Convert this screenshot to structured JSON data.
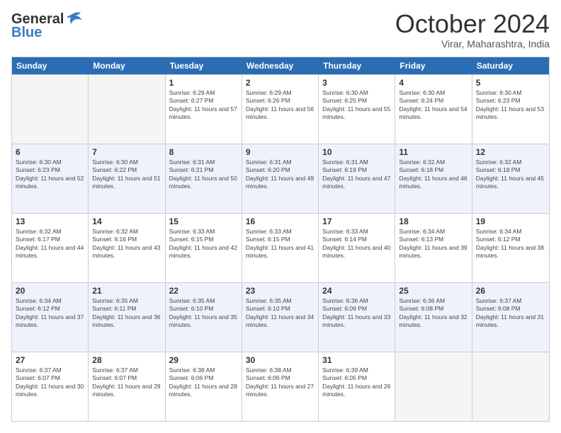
{
  "logo": {
    "text1": "General",
    "text2": "Blue"
  },
  "title": "October 2024",
  "location": "Virar, Maharashtra, India",
  "days_of_week": [
    "Sunday",
    "Monday",
    "Tuesday",
    "Wednesday",
    "Thursday",
    "Friday",
    "Saturday"
  ],
  "weeks": [
    {
      "alt": false,
      "cells": [
        {
          "day": "",
          "empty": true
        },
        {
          "day": "",
          "empty": true
        },
        {
          "day": "1",
          "sunrise": "Sunrise: 6:29 AM",
          "sunset": "Sunset: 6:27 PM",
          "daylight": "Daylight: 11 hours and 57 minutes."
        },
        {
          "day": "2",
          "sunrise": "Sunrise: 6:29 AM",
          "sunset": "Sunset: 6:26 PM",
          "daylight": "Daylight: 11 hours and 56 minutes."
        },
        {
          "day": "3",
          "sunrise": "Sunrise: 6:30 AM",
          "sunset": "Sunset: 6:25 PM",
          "daylight": "Daylight: 11 hours and 55 minutes."
        },
        {
          "day": "4",
          "sunrise": "Sunrise: 6:30 AM",
          "sunset": "Sunset: 6:24 PM",
          "daylight": "Daylight: 11 hours and 54 minutes."
        },
        {
          "day": "5",
          "sunrise": "Sunrise: 6:30 AM",
          "sunset": "Sunset: 6:23 PM",
          "daylight": "Daylight: 11 hours and 53 minutes."
        }
      ]
    },
    {
      "alt": true,
      "cells": [
        {
          "day": "6",
          "sunrise": "Sunrise: 6:30 AM",
          "sunset": "Sunset: 6:23 PM",
          "daylight": "Daylight: 11 hours and 52 minutes."
        },
        {
          "day": "7",
          "sunrise": "Sunrise: 6:30 AM",
          "sunset": "Sunset: 6:22 PM",
          "daylight": "Daylight: 11 hours and 51 minutes."
        },
        {
          "day": "8",
          "sunrise": "Sunrise: 6:31 AM",
          "sunset": "Sunset: 6:21 PM",
          "daylight": "Daylight: 11 hours and 50 minutes."
        },
        {
          "day": "9",
          "sunrise": "Sunrise: 6:31 AM",
          "sunset": "Sunset: 6:20 PM",
          "daylight": "Daylight: 11 hours and 49 minutes."
        },
        {
          "day": "10",
          "sunrise": "Sunrise: 6:31 AM",
          "sunset": "Sunset: 6:19 PM",
          "daylight": "Daylight: 11 hours and 47 minutes."
        },
        {
          "day": "11",
          "sunrise": "Sunrise: 6:32 AM",
          "sunset": "Sunset: 6:18 PM",
          "daylight": "Daylight: 11 hours and 46 minutes."
        },
        {
          "day": "12",
          "sunrise": "Sunrise: 6:32 AM",
          "sunset": "Sunset: 6:18 PM",
          "daylight": "Daylight: 11 hours and 45 minutes."
        }
      ]
    },
    {
      "alt": false,
      "cells": [
        {
          "day": "13",
          "sunrise": "Sunrise: 6:32 AM",
          "sunset": "Sunset: 6:17 PM",
          "daylight": "Daylight: 11 hours and 44 minutes."
        },
        {
          "day": "14",
          "sunrise": "Sunrise: 6:32 AM",
          "sunset": "Sunset: 6:16 PM",
          "daylight": "Daylight: 11 hours and 43 minutes."
        },
        {
          "day": "15",
          "sunrise": "Sunrise: 6:33 AM",
          "sunset": "Sunset: 6:15 PM",
          "daylight": "Daylight: 11 hours and 42 minutes."
        },
        {
          "day": "16",
          "sunrise": "Sunrise: 6:33 AM",
          "sunset": "Sunset: 6:15 PM",
          "daylight": "Daylight: 11 hours and 41 minutes."
        },
        {
          "day": "17",
          "sunrise": "Sunrise: 6:33 AM",
          "sunset": "Sunset: 6:14 PM",
          "daylight": "Daylight: 11 hours and 40 minutes."
        },
        {
          "day": "18",
          "sunrise": "Sunrise: 6:34 AM",
          "sunset": "Sunset: 6:13 PM",
          "daylight": "Daylight: 11 hours and 39 minutes."
        },
        {
          "day": "19",
          "sunrise": "Sunrise: 6:34 AM",
          "sunset": "Sunset: 6:12 PM",
          "daylight": "Daylight: 11 hours and 38 minutes."
        }
      ]
    },
    {
      "alt": true,
      "cells": [
        {
          "day": "20",
          "sunrise": "Sunrise: 6:34 AM",
          "sunset": "Sunset: 6:12 PM",
          "daylight": "Daylight: 11 hours and 37 minutes."
        },
        {
          "day": "21",
          "sunrise": "Sunrise: 6:35 AM",
          "sunset": "Sunset: 6:11 PM",
          "daylight": "Daylight: 11 hours and 36 minutes."
        },
        {
          "day": "22",
          "sunrise": "Sunrise: 6:35 AM",
          "sunset": "Sunset: 6:10 PM",
          "daylight": "Daylight: 11 hours and 35 minutes."
        },
        {
          "day": "23",
          "sunrise": "Sunrise: 6:35 AM",
          "sunset": "Sunset: 6:10 PM",
          "daylight": "Daylight: 11 hours and 34 minutes."
        },
        {
          "day": "24",
          "sunrise": "Sunrise: 6:36 AM",
          "sunset": "Sunset: 6:09 PM",
          "daylight": "Daylight: 11 hours and 33 minutes."
        },
        {
          "day": "25",
          "sunrise": "Sunrise: 6:36 AM",
          "sunset": "Sunset: 6:08 PM",
          "daylight": "Daylight: 11 hours and 32 minutes."
        },
        {
          "day": "26",
          "sunrise": "Sunrise: 6:37 AM",
          "sunset": "Sunset: 6:08 PM",
          "daylight": "Daylight: 11 hours and 31 minutes."
        }
      ]
    },
    {
      "alt": false,
      "cells": [
        {
          "day": "27",
          "sunrise": "Sunrise: 6:37 AM",
          "sunset": "Sunset: 6:07 PM",
          "daylight": "Daylight: 11 hours and 30 minutes."
        },
        {
          "day": "28",
          "sunrise": "Sunrise: 6:37 AM",
          "sunset": "Sunset: 6:07 PM",
          "daylight": "Daylight: 11 hours and 29 minutes."
        },
        {
          "day": "29",
          "sunrise": "Sunrise: 6:38 AM",
          "sunset": "Sunset: 6:06 PM",
          "daylight": "Daylight: 11 hours and 28 minutes."
        },
        {
          "day": "30",
          "sunrise": "Sunrise: 6:38 AM",
          "sunset": "Sunset: 6:06 PM",
          "daylight": "Daylight: 11 hours and 27 minutes."
        },
        {
          "day": "31",
          "sunrise": "Sunrise: 6:39 AM",
          "sunset": "Sunset: 6:05 PM",
          "daylight": "Daylight: 11 hours and 26 minutes."
        },
        {
          "day": "",
          "empty": true
        },
        {
          "day": "",
          "empty": true
        }
      ]
    }
  ]
}
